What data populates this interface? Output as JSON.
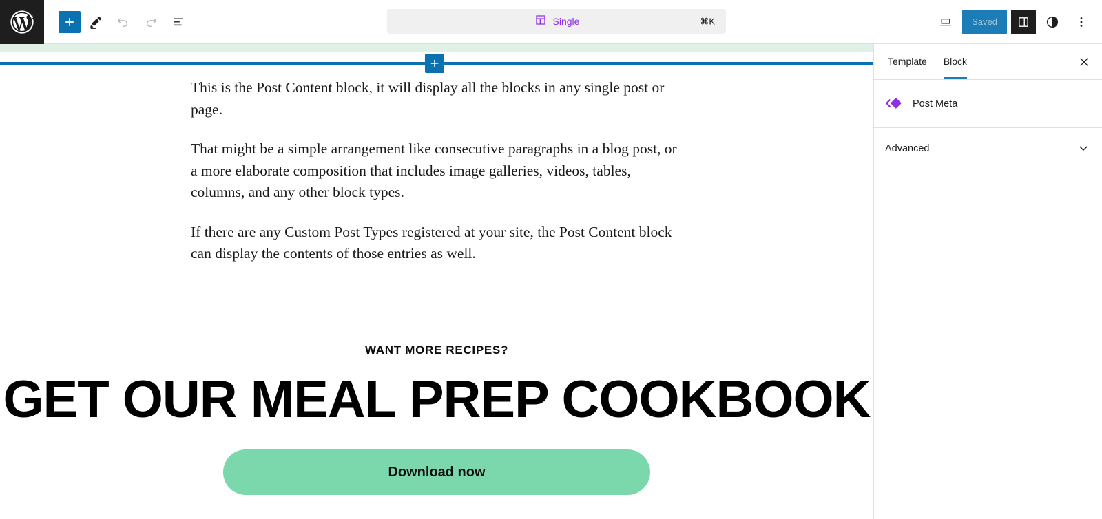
{
  "app": {
    "logo_icon": "wordpress-logo-icon"
  },
  "toolbar": {
    "add_block_label": "+",
    "add_block_icon": "plus-icon",
    "tools_icon": "pencil-edit-icon",
    "undo_icon": "undo-arrow-icon",
    "redo_icon": "redo-arrow-icon",
    "list_view_icon": "document-overview-icon",
    "view_icon": "desktop-preview-icon",
    "save_label": "Saved",
    "settings_icon": "settings-sidebar-icon",
    "styles_icon": "styles-contrast-icon",
    "options_icon": "more-options-vertical-dots-icon"
  },
  "document_bar": {
    "icon": "template-layout-icon",
    "title": "Single",
    "shortcut": "⌘K",
    "title_color": "#8c2eea"
  },
  "canvas": {
    "template_part_highlight_color": "#dff0e6",
    "insert_line_color": "#0b72b1",
    "inserter_icon": "plus-icon",
    "paragraphs": [
      "This is the Post Content block, it will display all the blocks in any single post or page.",
      "That might be a simple arrangement like consecutive paragraphs in a blog post, or a more elaborate composition that includes image galleries, videos, tables, columns, and any other block types.",
      "If there are any Custom Post Types registered at your site, the Post Content block can display the contents of those entries as well."
    ],
    "cta": {
      "eyebrow": "WANT MORE RECIPES?",
      "heading": "GET OUR MEAL PREP COOKBOOK",
      "button_label": "Download now",
      "button_color": "#7bd7ac",
      "button_text_color": "#11100f"
    }
  },
  "sidebar": {
    "tabs": [
      {
        "label": "Template",
        "active": false
      },
      {
        "label": "Block",
        "active": true
      }
    ],
    "close_icon": "close-x-icon",
    "active_tab_underline_color": "#1c7cb5",
    "block": {
      "icon": "post-meta-diamond-icon",
      "icon_color": "#8c2eea",
      "label": "Post Meta"
    },
    "advanced": {
      "label": "Advanced",
      "chevron_icon": "chevron-down-icon"
    }
  }
}
